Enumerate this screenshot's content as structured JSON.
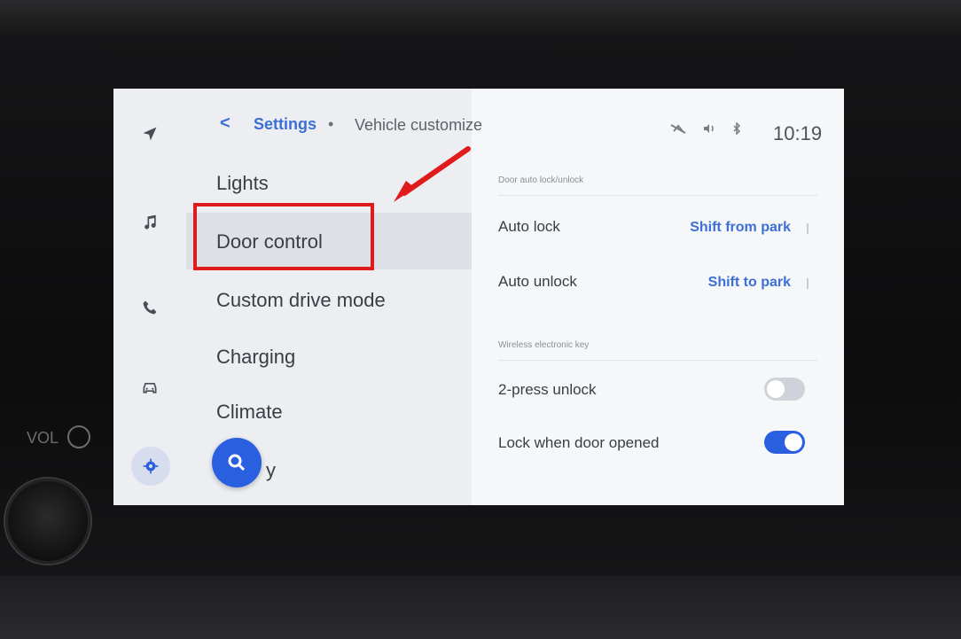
{
  "header": {
    "back_symbol": "<",
    "breadcrumb_parent": "Settings",
    "breadcrumb_separator": "•",
    "breadcrumb_current": "Vehicle customize",
    "status_icons": [
      "no-signal-icon",
      "volume-icon",
      "bluetooth-icon"
    ],
    "time": "10:19"
  },
  "rail": {
    "items": [
      {
        "icon": "navigation-icon"
      },
      {
        "icon": "music-note-icon"
      },
      {
        "icon": "phone-icon"
      },
      {
        "icon": "car-icon"
      },
      {
        "icon": "gear-icon",
        "selected": true
      }
    ]
  },
  "menu": {
    "items": [
      {
        "label": "Lights"
      },
      {
        "label": "Door control",
        "selected": true
      },
      {
        "label": "Custom drive mode"
      },
      {
        "label": "Charging"
      },
      {
        "label": "Climate"
      },
      {
        "label": "y"
      }
    ]
  },
  "search_fab": {
    "icon": "search-icon"
  },
  "detail": {
    "section1_label": "Door auto lock/unlock",
    "auto_lock": {
      "label": "Auto lock",
      "value": "Shift from park"
    },
    "auto_unlock": {
      "label": "Auto unlock",
      "value": "Shift to park"
    },
    "section2_label": "Wireless electronic key",
    "two_press_unlock": {
      "label": "2-press unlock",
      "enabled": false
    },
    "lock_when_door_opened": {
      "label": "Lock when door opened",
      "enabled": true
    }
  },
  "bezel": {
    "vol_label": "VOL"
  },
  "colors": {
    "accent": "#3b6fd6",
    "fab": "#2a5fe0",
    "annotation_red": "#e11b1b",
    "screen_bg": "#f3f4f6"
  }
}
